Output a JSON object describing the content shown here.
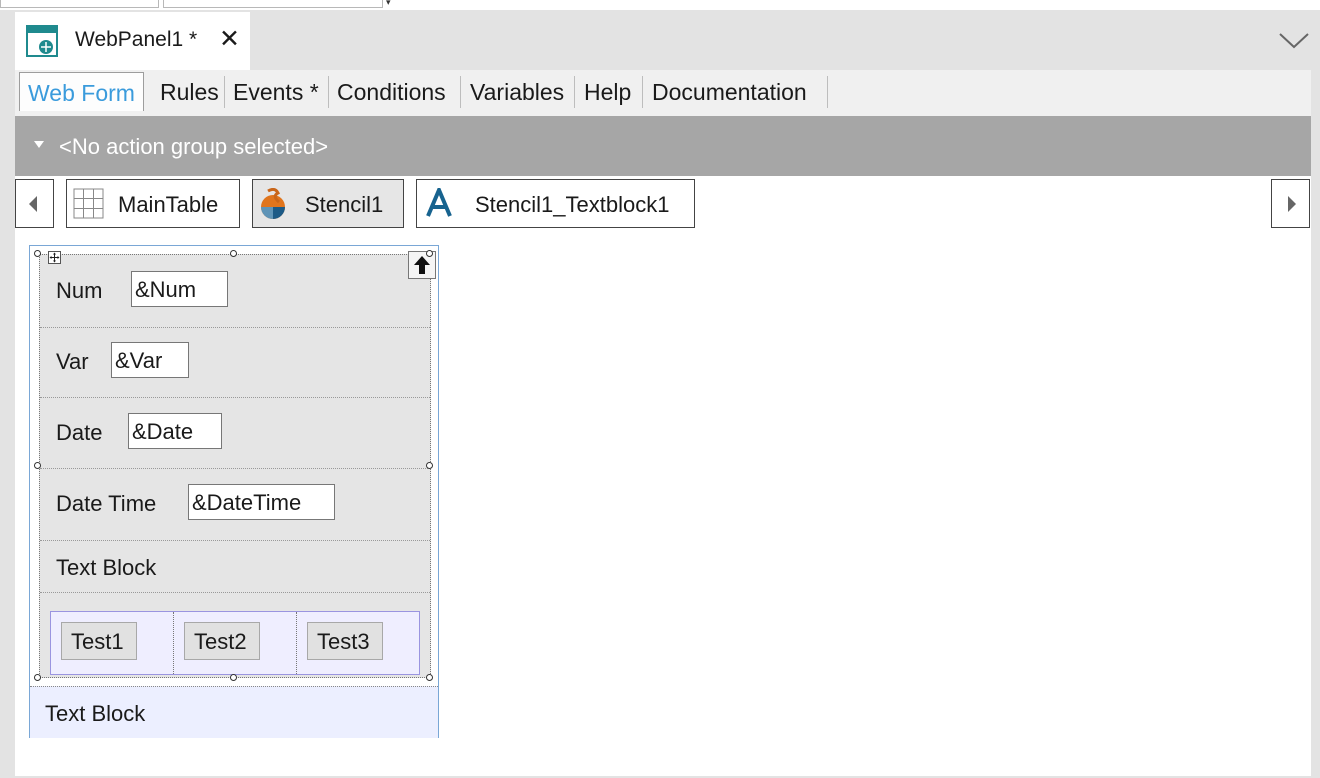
{
  "document_tab": {
    "title": "WebPanel1 *",
    "close_glyph": "✕"
  },
  "tabs": [
    {
      "label": "Web Form",
      "active": true
    },
    {
      "label": "Rules"
    },
    {
      "label": "Events *"
    },
    {
      "label": "Conditions"
    },
    {
      "label": "Variables"
    },
    {
      "label": "Help"
    },
    {
      "label": "Documentation"
    }
  ],
  "action_bar": {
    "label": "<No action group selected>"
  },
  "breadcrumbs": [
    {
      "label": "MainTable",
      "icon": "table-grid-icon"
    },
    {
      "label": "Stencil1",
      "icon": "stencil-icon"
    },
    {
      "label": "Stencil1_Textblock1",
      "icon": "text-a-icon"
    }
  ],
  "form": {
    "fields": [
      {
        "label": "Num",
        "value": "&Num"
      },
      {
        "label": "Var",
        "value": "&Var"
      },
      {
        "label": "Date",
        "value": "&Date"
      },
      {
        "label": "Date Time",
        "value": "&DateTime"
      }
    ],
    "text_block": "Text Block",
    "buttons": [
      "Test1",
      "Test2",
      "Test3"
    ],
    "outer_text_block": "Text Block"
  },
  "colors": {
    "active_tab": "#3a9bdc",
    "action_bar": "#a6a6a6",
    "stencil_border": "#7aa7d6"
  }
}
